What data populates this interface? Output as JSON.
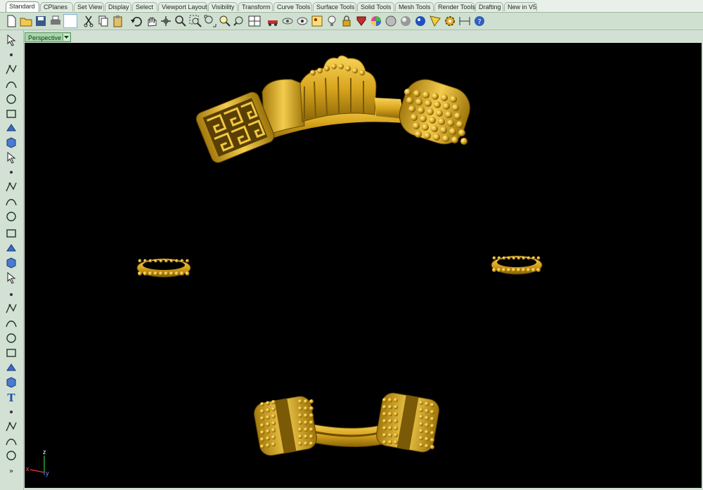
{
  "tabs": [
    {
      "label": "Standard",
      "active": true
    },
    {
      "label": "CPlanes"
    },
    {
      "label": "Set View"
    },
    {
      "label": "Display"
    },
    {
      "label": "Select"
    },
    {
      "label": "Viewport Layout"
    },
    {
      "label": "Visibility"
    },
    {
      "label": "Transform"
    },
    {
      "label": "Curve Tools"
    },
    {
      "label": "Surface Tools"
    },
    {
      "label": "Solid Tools"
    },
    {
      "label": "Mesh Tools"
    },
    {
      "label": "Render Tools"
    },
    {
      "label": "Drafting"
    },
    {
      "label": "New in V5"
    }
  ],
  "toolbar_icons": [
    "new-file-icon",
    "open-folder-icon",
    "save-icon",
    "print-icon",
    "blank-select-icon",
    "cut-icon",
    "copy-icon",
    "paste-icon",
    "undo-icon",
    "pan-hand-icon",
    "rotate-view-icon",
    "zoom-icon",
    "zoom-window-icon",
    "zoom-extents-icon",
    "zoom-selected-icon",
    "undo-view-icon",
    "four-viewports-icon",
    "car-object-icon",
    "hide-objects-icon",
    "show-objects-icon",
    "grid-snap-icon",
    "light-bulb-icon",
    "lock-icon",
    "layer-palette-icon",
    "color-wheel-icon",
    "render-sphere-icon",
    "rendered-sphere-icon",
    "material-sphere-icon",
    "highlight-icon",
    "options-gear-icon",
    "dimension-icon",
    "help-icon"
  ],
  "sidebar_icons": [
    "select-arrow-icon",
    "point-icon",
    "polyline-icon",
    "curve-icon",
    "circle-icon",
    "ellipse-icon",
    "polygon-icon",
    "rectangle-icon",
    "arc-icon",
    "fillet-icon",
    "surface-corner-icon",
    "sweep-icon",
    "box-solid-icon",
    "sphere-solid-icon",
    "cylinder-solid-icon",
    "mesh-icon",
    "point-editing-icon",
    "boolean-icon",
    "split-icon",
    "trim-icon",
    "group-icon",
    "array-icon",
    "move-icon",
    "scale-icon",
    "text-tool-icon",
    "dimension-tool-icon",
    "snap-grid-icon",
    "mirror-tool-icon",
    "render-box-icon",
    "more-tools-icon"
  ],
  "viewport": {
    "label": "Perspective"
  },
  "axis": {
    "x": "x",
    "y": "y",
    "z": "z"
  },
  "colors": {
    "gold": "#e0b02b",
    "gold_dark": "#7a5a06",
    "background": "#000000"
  }
}
